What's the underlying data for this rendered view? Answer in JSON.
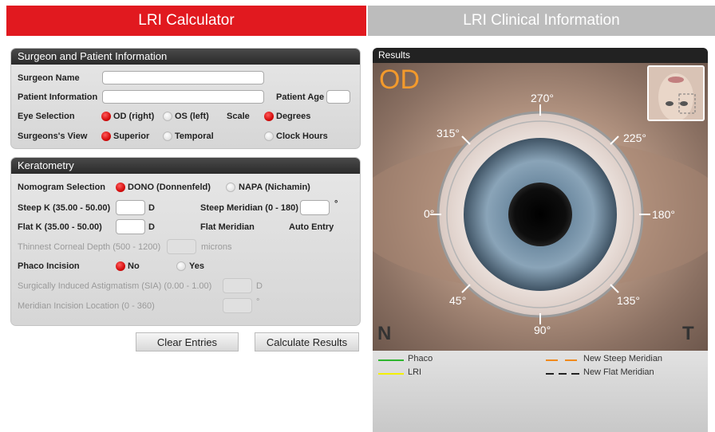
{
  "tabs": {
    "calculator": "LRI Calculator",
    "clinical": "LRI Clinical Information"
  },
  "surgeon_panel": {
    "title": "Surgeon and Patient Information",
    "surgeon_name_label": "Surgeon Name",
    "patient_info_label": "Patient Information",
    "patient_age_label": "Patient Age",
    "eye_selection_label": "Eye Selection",
    "eye_od": "OD (right)",
    "eye_os": "OS (left)",
    "scale_label": "Scale",
    "scale_degrees": "Degrees",
    "view_label": "Surgeons's View",
    "view_superior": "Superior",
    "view_temporal": "Temporal",
    "view_clock": "Clock Hours"
  },
  "kerato_panel": {
    "title": "Keratometry",
    "nomogram_label": "Nomogram Selection",
    "nomogram_dono": "DONO (Donnenfeld)",
    "nomogram_napa": "NAPA (Nichamin)",
    "steep_k_label": "Steep K (35.00 - 50.00)",
    "steep_k_unit": "D",
    "steep_meridian_label": "Steep Meridian (0 - 180)",
    "steep_meridian_unit": "°",
    "flat_k_label": "Flat K (35.00 - 50.00)",
    "flat_k_unit": "D",
    "flat_meridian_label": "Flat Meridian",
    "flat_meridian_value": "Auto Entry",
    "thinnest_label": "Thinnest Corneal Depth (500 - 1200)",
    "thinnest_unit": "microns",
    "phaco_label": "Phaco Incision",
    "phaco_no": "No",
    "phaco_yes": "Yes",
    "sia_label": "Surgically Induced Astigmatism (SIA) (0.00 - 1.00)",
    "sia_unit": "D",
    "meridian_inc_label": "Meridian Incision Location (0 - 360)",
    "meridian_inc_unit": "°"
  },
  "buttons": {
    "clear": "Clear Entries",
    "calculate": "Calculate Results"
  },
  "results": {
    "title": "Results",
    "eye": "OD",
    "nasal": "N",
    "temporal": "T",
    "degrees": {
      "d270": "270°",
      "d315": "315°",
      "d225": "225°",
      "d0": "0°",
      "d180": "180°",
      "d45": "45°",
      "d135": "135°",
      "d90": "90°"
    },
    "legend": {
      "phaco": "Phaco",
      "lri": "LRI",
      "new_steep": "New Steep Meridian",
      "new_flat": "New Flat Meridian",
      "phaco_color": "#2fb52f",
      "lri_color": "#f3f000",
      "steep_color": "#f08a1c",
      "flat_color": "#222222"
    }
  },
  "colors": {
    "accent": "#e1191f",
    "od": "#f39a2c"
  }
}
